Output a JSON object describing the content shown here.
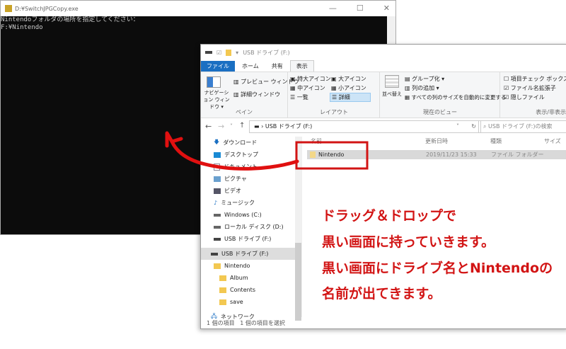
{
  "console": {
    "title": "D:¥SwitchJPGCopy.exe",
    "min": "—",
    "max": "☐",
    "close": "✕",
    "lines": [
      "Nintendoフォルダの場所を指定してください：",
      "F:¥Nintendo"
    ]
  },
  "explorer": {
    "title": "USB ドライブ (F:)",
    "tabs": [
      "ファイル",
      "ホーム",
      "共有",
      "表示"
    ],
    "ribbon": {
      "pane": {
        "nav": "ナビゲーション ウィンドウ ▾",
        "preview": "プレビュー ウィンドウ",
        "details": "詳細ウィンドウ",
        "label": "ペイン"
      },
      "layout": {
        "items": [
          "特大アイコン",
          "大アイコン",
          "中アイコン",
          "小アイコン",
          "一覧",
          "詳細"
        ],
        "label": "レイアウト"
      },
      "view": {
        "sort": "並べ替え",
        "group": "グループ化 ▾",
        "addcol": "列の追加 ▾",
        "fit": "すべての列のサイズを自動的に変更する",
        "label": "現在のビュー"
      },
      "show": {
        "items": [
          {
            "label": "項目チェック ボックス",
            "checked": false
          },
          {
            "label": "ファイル名拡張子",
            "checked": true
          },
          {
            "label": "隠しファイル",
            "checked": true
          }
        ],
        "label": "表示/非表示"
      }
    },
    "address": "USB ドライブ (F:)",
    "search_placeholder": "USB ドライブ (F:)の検索",
    "sidebar": [
      "ダウンロード",
      "デスクトップ",
      "ドキュメント",
      "ピクチャ",
      "ビデオ",
      "ミュージック",
      "Windows (C:)",
      "ローカル ディスク (D:)",
      "USB ドライブ (F:)",
      "USB ドライブ (F:)",
      "Nintendo",
      "Album",
      "Contents",
      "save",
      "ネットワーク"
    ],
    "columns": [
      "名前",
      "更新日時",
      "種類",
      "サイズ"
    ],
    "files": [
      {
        "name": "Nintendo",
        "date": "2019/11/23 15:33",
        "type": "ファイル フォルダー",
        "size": ""
      }
    ],
    "status": [
      "1 個の項目",
      "1 個の項目を選択"
    ]
  },
  "annotation": [
    "ドラッグ＆ドロップで",
    "黒い画面に持っていきます。",
    "黒い画面にドライブ名とNintendoの",
    "名前が出てきます。"
  ],
  "colors": {
    "accent": "#1a6fc2",
    "annotation": "#d21414"
  }
}
